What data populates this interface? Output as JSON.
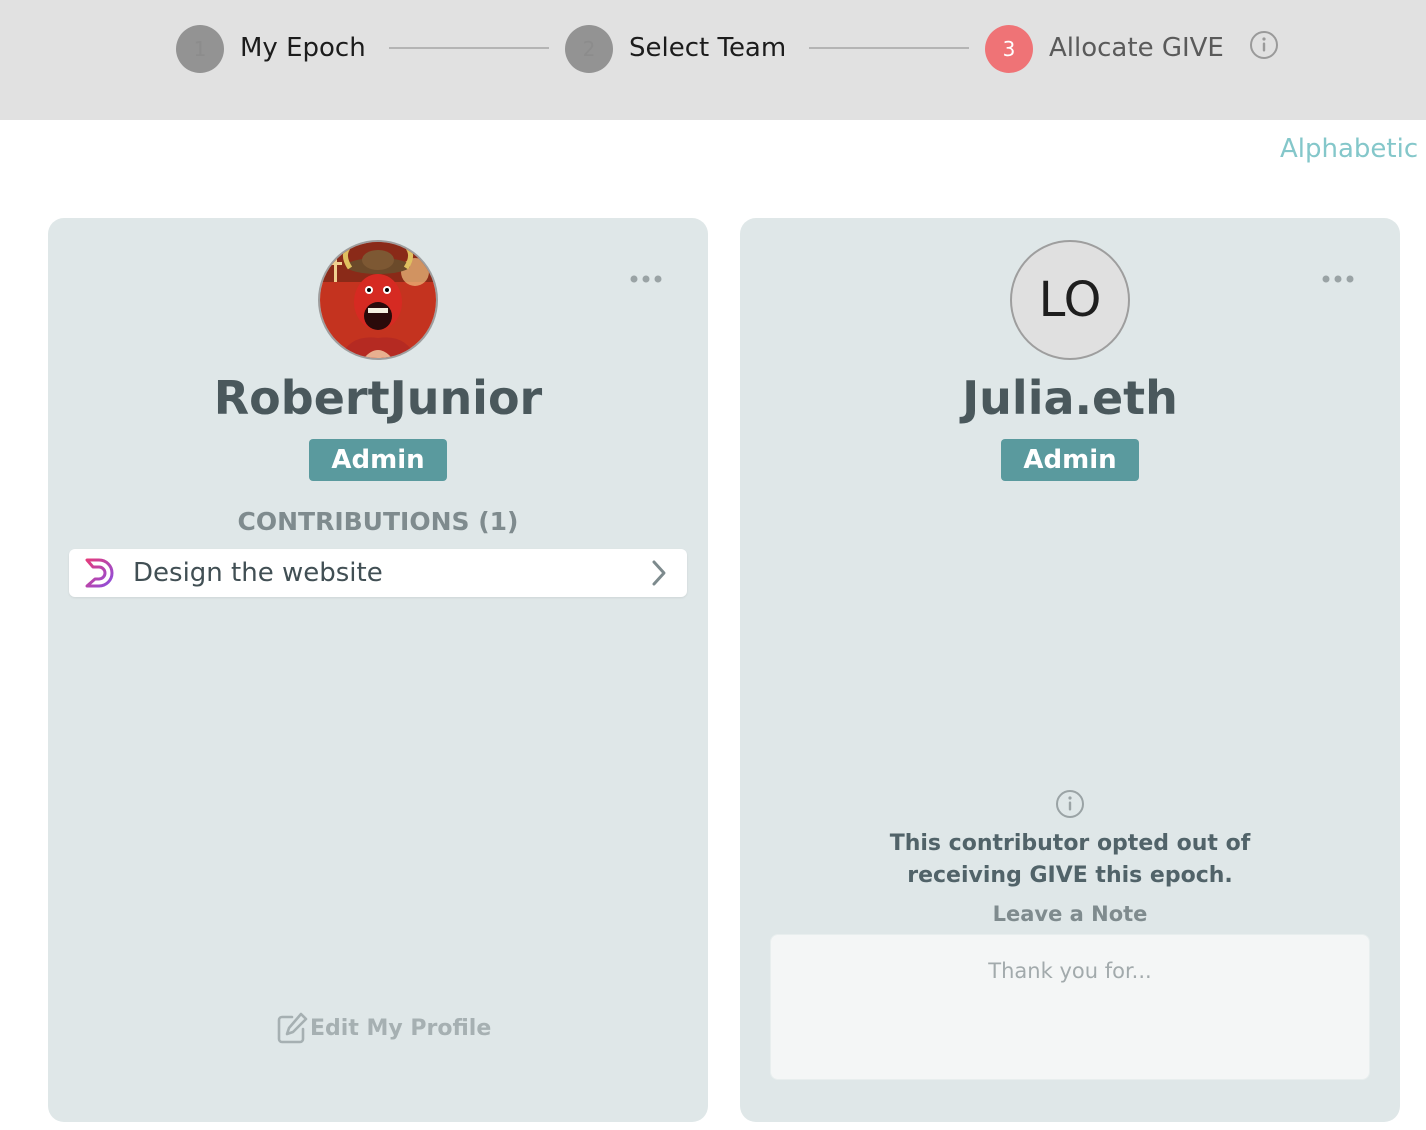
{
  "stepper": {
    "steps": [
      {
        "number": "1",
        "label": "My Epoch"
      },
      {
        "number": "2",
        "label": "Select Team"
      },
      {
        "number": "3",
        "label": "Allocate GIVE"
      }
    ],
    "active_step": 3
  },
  "sort": {
    "label": "Alphabetic"
  },
  "cards": [
    {
      "name": "RobertJunior",
      "role": "Admin",
      "avatar": "robert-avatar-image",
      "contributions_heading": "CONTRIBUTIONS (1)",
      "contributions": [
        {
          "title": "Design the website",
          "icon": "dework-logo-icon"
        }
      ],
      "edit_profile_label": "Edit My Profile"
    },
    {
      "name": "Julia.eth",
      "role": "Admin",
      "initials": "LO",
      "opt_out_message": "This contributor opted out of receiving GIVE this epoch.",
      "note_label": "Leave a Note",
      "note_placeholder": "Thank you for...",
      "note_value": ""
    }
  ],
  "colors": {
    "header_bg": "#e1e1e1",
    "active_step": "#ef7376",
    "inactive_step": "#939393",
    "card_bg": "#dfe7e8",
    "badge_bg": "#5a9a9e",
    "sort_link": "#84c7ca"
  }
}
